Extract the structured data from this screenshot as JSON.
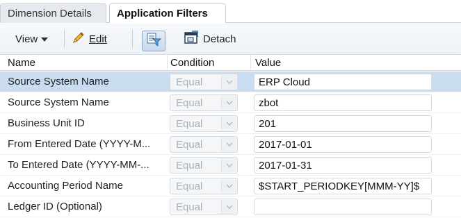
{
  "tabs": [
    {
      "label": "Dimension Details",
      "active": false
    },
    {
      "label": "Application Filters",
      "active": true
    }
  ],
  "toolbar": {
    "view_label": "View",
    "edit_label": "Edit",
    "detach_label": "Detach",
    "icons": [
      "pencil-icon",
      "filter-icon",
      "detach-icon",
      "chevron-down-icon"
    ]
  },
  "grid": {
    "headers": {
      "name": "Name",
      "condition": "Condition",
      "value": "Value"
    },
    "rows": [
      {
        "name": "Source System Name",
        "condition": "Equal",
        "value": "ERP Cloud",
        "selected": true
      },
      {
        "name": "Source System Name",
        "condition": "Equal",
        "value": "zbot",
        "selected": false
      },
      {
        "name": "Business Unit ID",
        "condition": "Equal",
        "value": "201",
        "selected": false
      },
      {
        "name": "From Entered Date (YYYY-M...",
        "condition": "Equal",
        "value": "2017-01-01",
        "selected": false
      },
      {
        "name": "To Entered Date (YYYY-MM-...",
        "condition": "Equal",
        "value": "2017-01-31",
        "selected": false
      },
      {
        "name": "Accounting Period Name",
        "condition": "Equal",
        "value": "$START_PERIODKEY[MMM-YY]$",
        "selected": false
      },
      {
        "name": "Ledger ID (Optional)",
        "condition": "Equal",
        "value": "",
        "selected": false
      }
    ]
  },
  "colors": {
    "selected_row": "#c9dcf0",
    "accent": "#2e6da4"
  }
}
